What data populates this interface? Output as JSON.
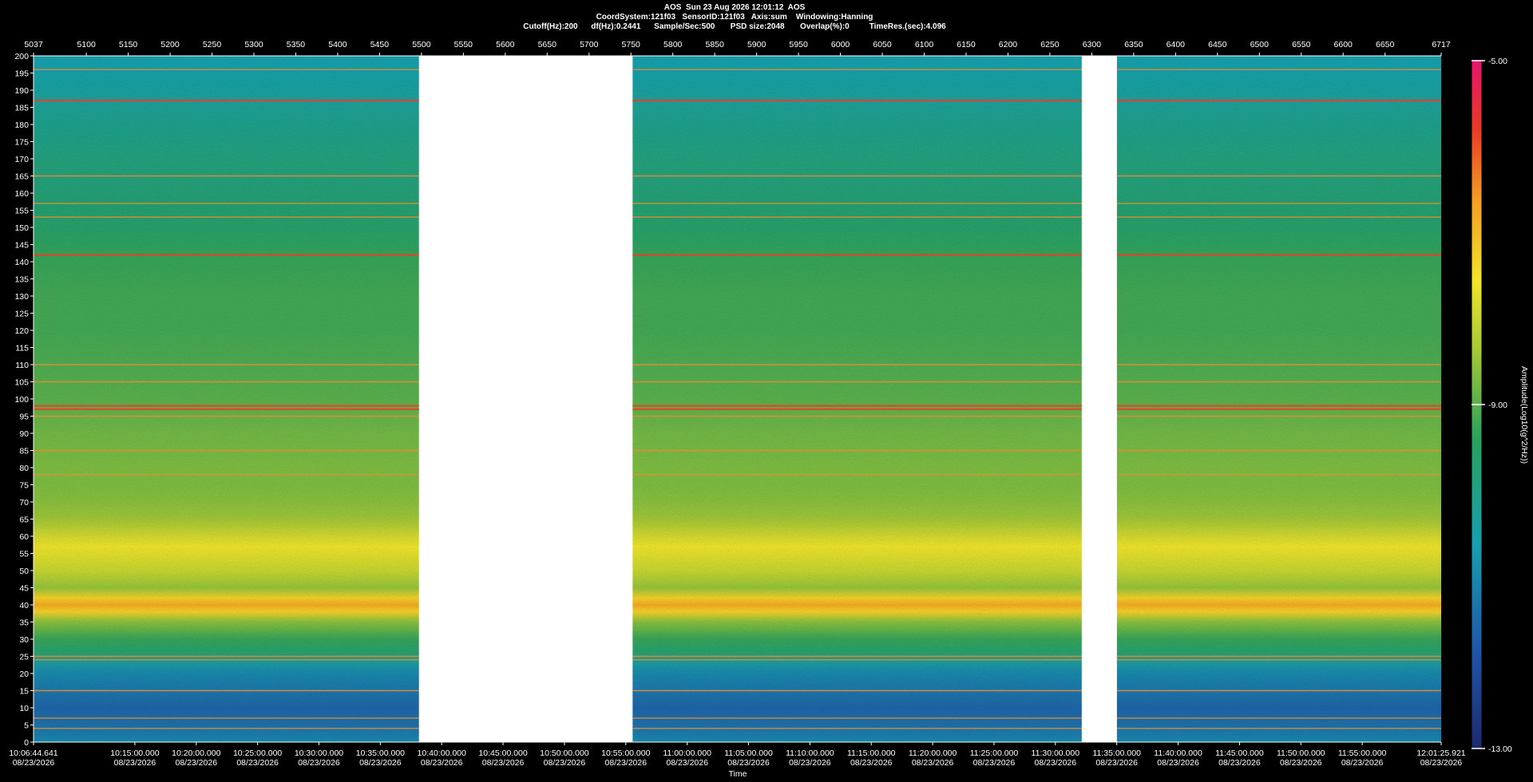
{
  "header": {
    "line1": "AOS  Sun 23 Aug 2026 12:01:12  AOS",
    "line2": "CoordSystem:121f03   SensorID:121f03   Axis:sum    Windowing:Hanning",
    "line3": "Cutoff(Hz):200      df(Hz):0.2441      Sample/Sec:500       PSD size:2048       Overlap(%):0         TimeRes.(sec):4.096"
  },
  "chart_data": {
    "type": "heatmap",
    "xlabel": "Time",
    "colorbar_label": "Amplitude(Log10(g^2/Hz))",
    "colorbar_ticks": [
      "-5.00",
      "-9.00",
      "-13.00"
    ],
    "colorbar_range": [
      -13,
      -5
    ],
    "ylim": [
      0,
      200
    ],
    "y_ticks": [
      0,
      5,
      10,
      15,
      20,
      25,
      30,
      35,
      40,
      45,
      50,
      55,
      60,
      65,
      70,
      75,
      80,
      85,
      90,
      95,
      100,
      105,
      110,
      115,
      120,
      125,
      130,
      135,
      140,
      145,
      150,
      155,
      160,
      165,
      170,
      175,
      180,
      185,
      190,
      195,
      200
    ],
    "top_axis_range": [
      5037,
      6717
    ],
    "top_ticks": [
      "5037",
      "5100",
      "5150",
      "5200",
      "5250",
      "5300",
      "5350",
      "5400",
      "5450",
      "5500",
      "5550",
      "5600",
      "5650",
      "5700",
      "5750",
      "5800",
      "5850",
      "5900",
      "5950",
      "6000",
      "6050",
      "6100",
      "6150",
      "6200",
      "6250",
      "6300",
      "6350",
      "6400",
      "6450",
      "6500",
      "6550",
      "6600",
      "6650",
      "6717"
    ],
    "top_tick_values": [
      5037,
      5100,
      5150,
      5200,
      5250,
      5300,
      5350,
      5400,
      5450,
      5500,
      5550,
      5600,
      5650,
      5700,
      5750,
      5800,
      5850,
      5900,
      5950,
      6000,
      6050,
      6100,
      6150,
      6200,
      6250,
      6300,
      6350,
      6400,
      6450,
      6500,
      6550,
      6600,
      6650,
      6717
    ],
    "time_range": [
      "10:06:44.641",
      "12:01:25.921"
    ],
    "time_range_sec": [
      36404.641,
      43285.921
    ],
    "time_ticks": [
      {
        "time": "10:06:44.641",
        "date": "08/23/2026",
        "sec": 36404.641
      },
      {
        "time": "10:15:00.000",
        "date": "08/23/2026",
        "sec": 36900
      },
      {
        "time": "10:20:00.000",
        "date": "08/23/2026",
        "sec": 37200
      },
      {
        "time": "10:25:00.000",
        "date": "08/23/2026",
        "sec": 37500
      },
      {
        "time": "10:30:00.000",
        "date": "08/23/2026",
        "sec": 37800
      },
      {
        "time": "10:35:00.000",
        "date": "08/23/2026",
        "sec": 38100
      },
      {
        "time": "10:40:00.000",
        "date": "08/23/2026",
        "sec": 38400
      },
      {
        "time": "10:45:00.000",
        "date": "08/23/2026",
        "sec": 38700
      },
      {
        "time": "10:50:00.000",
        "date": "08/23/2026",
        "sec": 39000
      },
      {
        "time": "10:55:00.000",
        "date": "08/23/2026",
        "sec": 39300
      },
      {
        "time": "11:00:00.000",
        "date": "08/23/2026",
        "sec": 39600
      },
      {
        "time": "11:05:00.000",
        "date": "08/23/2026",
        "sec": 39900
      },
      {
        "time": "11:10:00.000",
        "date": "08/23/2026",
        "sec": 40200
      },
      {
        "time": "11:15:00.000",
        "date": "08/23/2026",
        "sec": 40500
      },
      {
        "time": "11:20:00.000",
        "date": "08/23/2026",
        "sec": 40800
      },
      {
        "time": "11:25:00.000",
        "date": "08/23/2026",
        "sec": 41100
      },
      {
        "time": "11:30:00.000",
        "date": "08/23/2026",
        "sec": 41400
      },
      {
        "time": "11:35:00.000",
        "date": "08/23/2026",
        "sec": 41700
      },
      {
        "time": "11:40:00.000",
        "date": "08/23/2026",
        "sec": 42000
      },
      {
        "time": "11:45:00.000",
        "date": "08/23/2026",
        "sec": 42300
      },
      {
        "time": "11:50:00.000",
        "date": "08/23/2026",
        "sec": 42600
      },
      {
        "time": "11:55:00.000",
        "date": "08/23/2026",
        "sec": 42900
      },
      {
        "time": "12:01:25.921",
        "date": "08/23/2026",
        "sec": 43285.921
      }
    ],
    "data_segments_top_axis": [
      [
        5037,
        5497
      ],
      [
        5752,
        6288
      ],
      [
        6330,
        6717
      ]
    ],
    "persistent_lines_hz": [
      4,
      7,
      15,
      24,
      25,
      78,
      85,
      95,
      97,
      98,
      105,
      110,
      142,
      153,
      157,
      165,
      187,
      196
    ],
    "spectral_profile": {
      "freq_hz": [
        0,
        5,
        10,
        15,
        20,
        24,
        25,
        30,
        35,
        38,
        40,
        42,
        45,
        50,
        55,
        57,
        60,
        65,
        70,
        75,
        80,
        90,
        100,
        110,
        120,
        130,
        140,
        150,
        160,
        170,
        180,
        190,
        200
      ],
      "amplitude_log10": [
        -11.0,
        -11.4,
        -11.6,
        -11.3,
        -11.0,
        -10.3,
        -9.8,
        -9.3,
        -8.6,
        -7.3,
        -6.8,
        -7.3,
        -8.5,
        -8.0,
        -7.7,
        -7.6,
        -7.9,
        -8.4,
        -8.6,
        -8.7,
        -8.7,
        -8.8,
        -9.0,
        -9.1,
        -9.2,
        -9.2,
        -9.3,
        -9.6,
        -9.8,
        -9.9,
        -10.1,
        -10.4,
        -10.6
      ]
    }
  }
}
